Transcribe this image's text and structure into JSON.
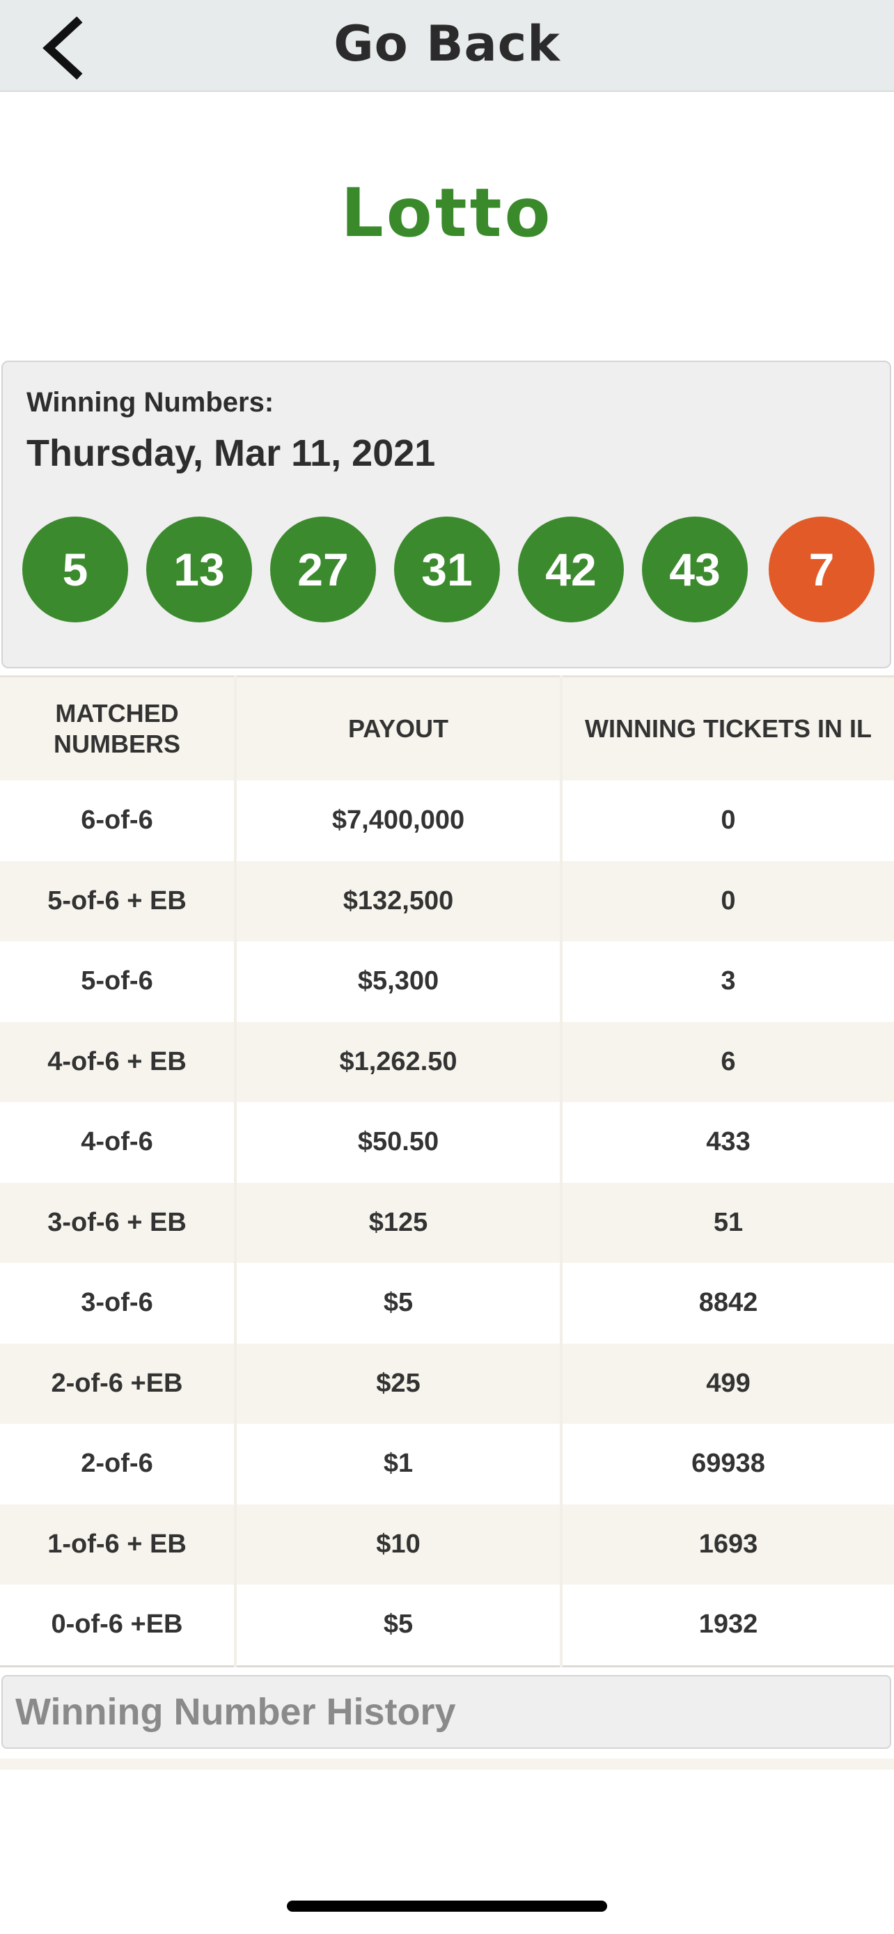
{
  "header": {
    "back_icon": "chevron-left-icon",
    "title": "Go Back"
  },
  "game": {
    "title": "Lotto"
  },
  "winning": {
    "label": "Winning Numbers:",
    "date": "Thursday, Mar 11, 2021",
    "numbers": [
      "5",
      "13",
      "27",
      "31",
      "42",
      "43"
    ],
    "extra_ball": "7",
    "colors": {
      "number_ball": "#3b8a2d",
      "extra_ball": "#e15a28",
      "title_green": "#3a8a2b"
    }
  },
  "table": {
    "headers": [
      "MATCHED NUMBERS",
      "PAYOUT",
      "WINNING TICKETS IN IL"
    ],
    "rows": [
      [
        "6-of-6",
        "$7,400,000",
        "0"
      ],
      [
        "5-of-6 + EB",
        "$132,500",
        "0"
      ],
      [
        "5-of-6",
        "$5,300",
        "3"
      ],
      [
        "4-of-6 + EB",
        "$1,262.50",
        "6"
      ],
      [
        "4-of-6",
        "$50.50",
        "433"
      ],
      [
        "3-of-6 + EB",
        "$125",
        "51"
      ],
      [
        "3-of-6",
        "$5",
        "8842"
      ],
      [
        "2-of-6 +EB",
        "$25",
        "499"
      ],
      [
        "2-of-6",
        "$1",
        "69938"
      ],
      [
        "1-of-6 + EB",
        "$10",
        "1693"
      ],
      [
        "0-of-6 +EB",
        "$5",
        "1932"
      ]
    ]
  },
  "history": {
    "title": "Winning Number History"
  }
}
